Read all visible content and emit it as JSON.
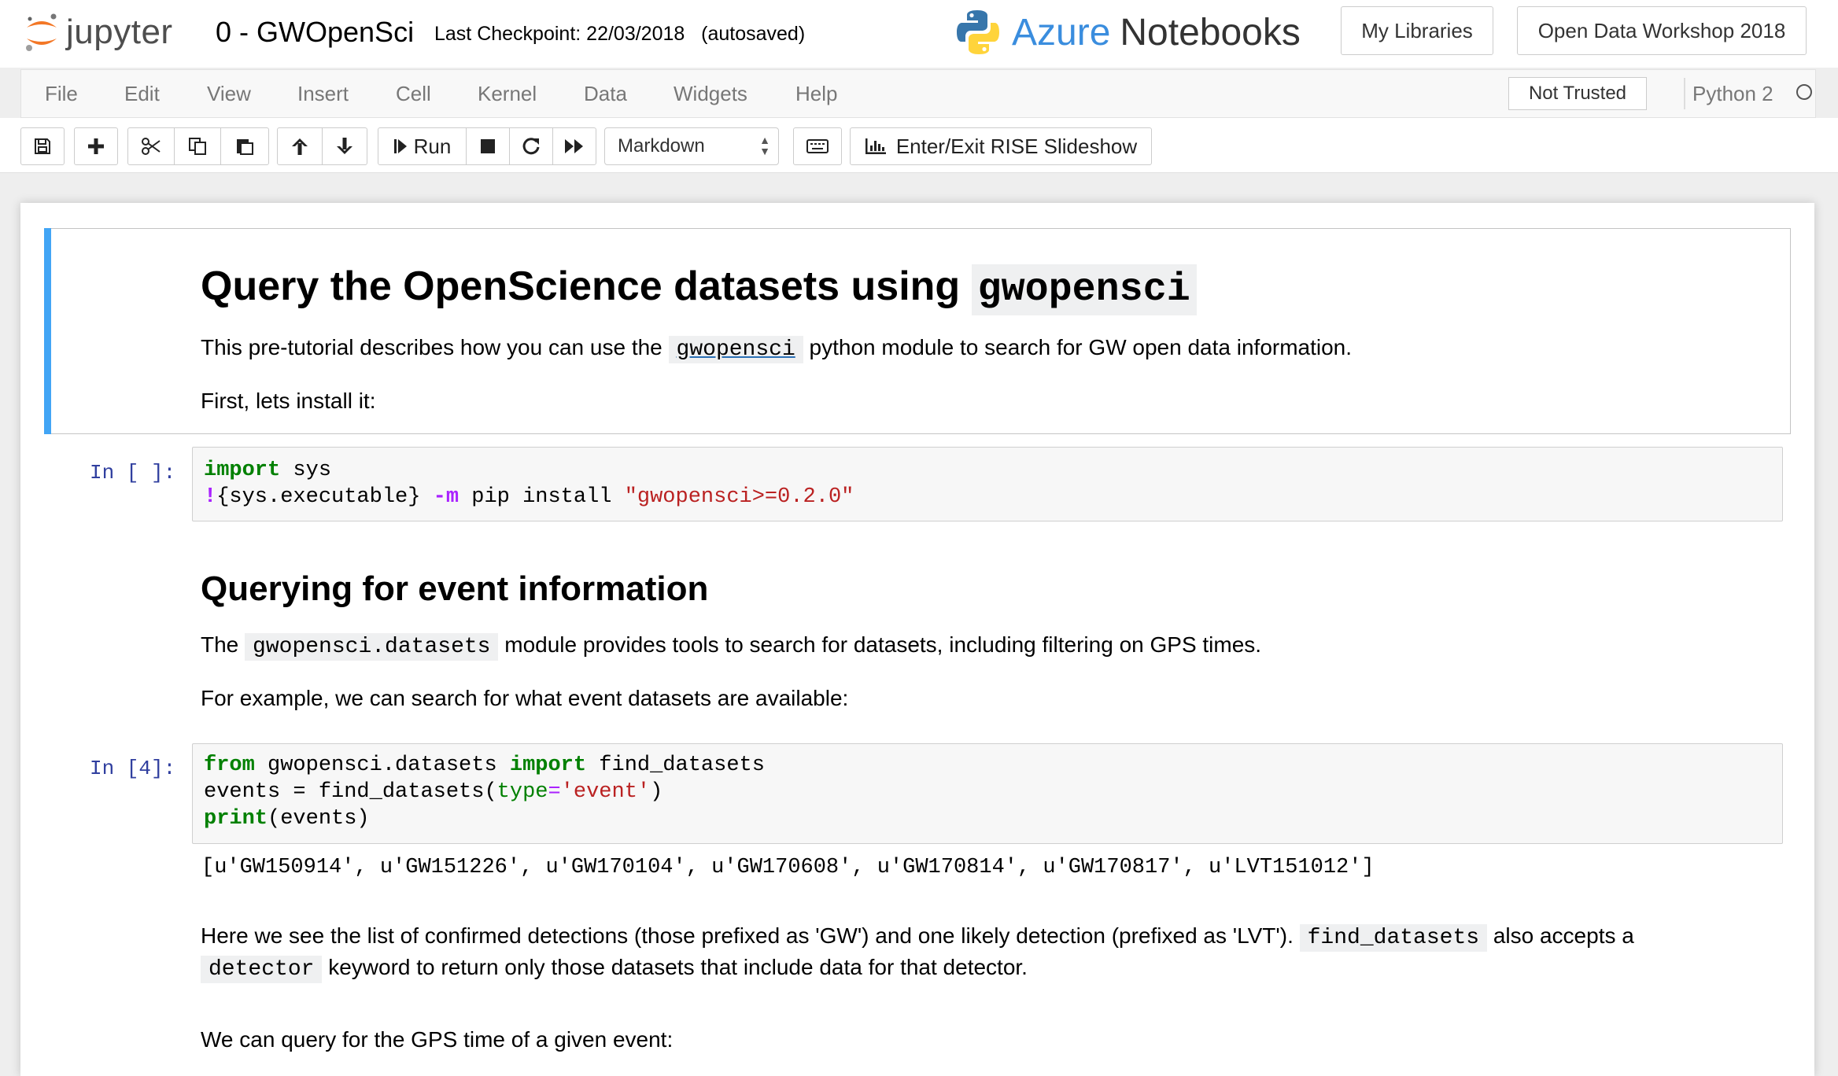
{
  "header": {
    "logo_text": "jupyter",
    "notebook_title": "0 - GWOpenSci",
    "checkpoint": "Last Checkpoint: 22/03/2018",
    "autosave": "(autosaved)",
    "brand_azure": "Azure",
    "brand_notebooks": "Notebooks",
    "my_libraries": "My Libraries",
    "workshop": "Open Data Workshop 2018",
    "colors": {
      "jupyter_orange": "#f37726",
      "azure_blue": "#3a8dde",
      "selection_blue": "#42a5f5"
    }
  },
  "menubar": {
    "items": [
      "File",
      "Edit",
      "View",
      "Insert",
      "Cell",
      "Kernel",
      "Data",
      "Widgets",
      "Help"
    ],
    "trust_status": "Not Trusted",
    "kernel": "Python 2"
  },
  "toolbar": {
    "icons": [
      "save-icon",
      "plus-icon",
      "scissors-icon",
      "copy-icon",
      "paste-icon",
      "arrow-up-icon",
      "arrow-down-icon",
      "step-forward-icon",
      "stop-icon",
      "restart-icon",
      "fast-forward-icon",
      "keyboard-icon",
      "bar-chart-icon"
    ],
    "run_label": "Run",
    "cell_type": "Markdown",
    "rise_label": "Enter/Exit RISE Slideshow"
  },
  "cells": {
    "md1": {
      "heading": "Query the OpenScience datasets using",
      "heading_code": "gwopensci",
      "p1_before": "This pre-tutorial describes how you can use the",
      "p1_code": "gwopensci",
      "p1_after": "python module to search for GW open data information.",
      "p2": "First, lets install it:"
    },
    "code1": {
      "prompt": "In [ ]:",
      "l1_kw": "import",
      "l1_rest": " sys",
      "l2_bang": "!",
      "l2_mid": "{sys.executable} ",
      "l2_opt": "-m",
      "l2_rest": " pip install ",
      "l2_str": "\"gwopensci>=0.2.0\""
    },
    "md2": {
      "heading": "Querying for event information",
      "p1_before": "The",
      "p1_code": "gwopensci.datasets",
      "p1_after": "module provides tools to search for datasets, including filtering on GPS times.",
      "p2": "For example, we can search for what event datasets are available:"
    },
    "code2": {
      "prompt": "In [4]:",
      "l1_kw1": "from",
      "l1_mid": " gwopensci.datasets ",
      "l1_kw2": "import",
      "l1_rest": " find_datasets",
      "l2_a": "events = find_datasets(",
      "l2_kw": "type",
      "l2_eq": "=",
      "l2_str": "'event'",
      "l2_end": ")",
      "l3_kw": "print",
      "l3_rest": "(events)",
      "output": "[u'GW150914', u'GW151226', u'GW170104', u'GW170608', u'GW170814', u'GW170817', u'LVT151012']"
    },
    "md3": {
      "p1_a": "Here we see the list of confirmed detections (those prefixed as 'GW') and one likely detection (prefixed as 'LVT').",
      "p1_code1": "find_datasets",
      "p1_b": "also accepts a",
      "p1_code2": "detector",
      "p1_c": "keyword to return only those datasets that include data for that detector.",
      "p2": "We can query for the GPS time of a given event:"
    }
  }
}
